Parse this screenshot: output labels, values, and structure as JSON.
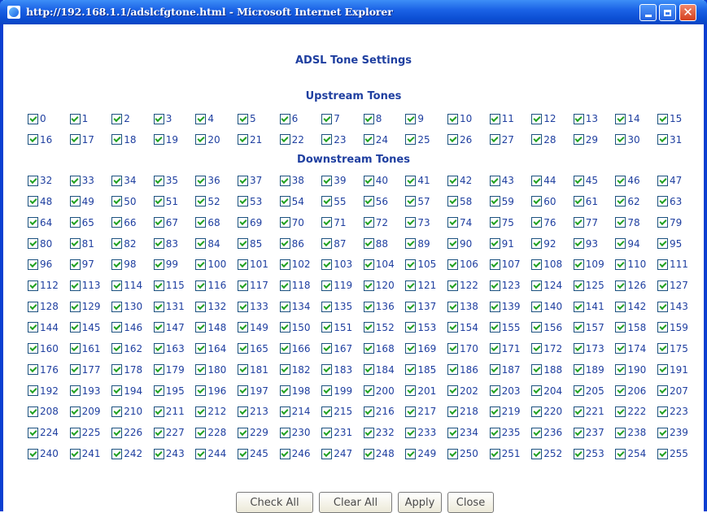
{
  "window": {
    "title": "http://192.168.1.1/adslcfgtone.html - Microsoft Internet Explorer",
    "controls": {
      "minimize_icon": "minimize-icon",
      "maximize_icon": "maximize-icon",
      "close_icon": "close-icon",
      "close_glyph": "✕"
    }
  },
  "page": {
    "title": "ADSL Tone Settings",
    "upstream_title": "Upstream Tones",
    "downstream_title": "Downstream Tones"
  },
  "tones": {
    "upstream_first": 0,
    "upstream_last": 31,
    "downstream_first": 32,
    "downstream_last": 255,
    "per_row": 16,
    "all_checked": true
  },
  "buttons": {
    "check_all": "Check All",
    "clear_all": "Clear All",
    "apply": "Apply",
    "close": "Close"
  },
  "colors": {
    "label": "#1f3fa0",
    "titlebar": "#1b63e6",
    "check": "#21a121"
  }
}
